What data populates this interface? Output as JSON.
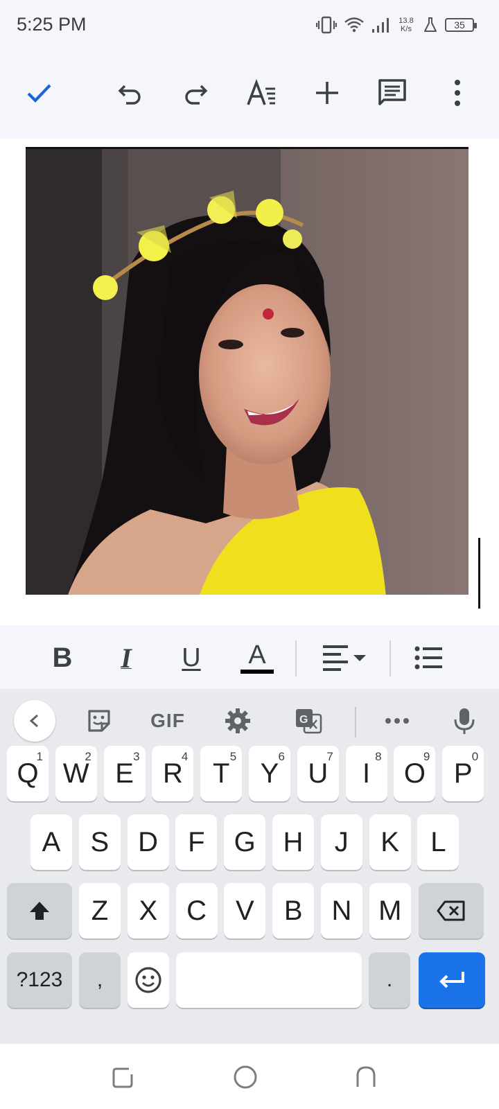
{
  "status_bar": {
    "time": "5:25 PM",
    "net_speed_value": "13.8",
    "net_speed_unit": "K/s",
    "battery": "35"
  },
  "doc_toolbar": {
    "icons": [
      "check-icon",
      "undo-icon",
      "redo-icon",
      "text-format-icon",
      "insert-plus-icon",
      "comment-icon",
      "more-vert-icon"
    ],
    "accent_color": "#1967d2"
  },
  "document": {
    "image_subject": "photo of a smiling woman wearing a yellow flower crown"
  },
  "format_bar": {
    "bold": "B",
    "italic": "I",
    "underline": "U",
    "text_color": "A",
    "icons": [
      "align-left-icon",
      "bulleted-list-icon"
    ]
  },
  "keyboard": {
    "toolbar": {
      "gif_label": "GIF",
      "icons": [
        "chevron-left-icon",
        "sticker-icon",
        "settings-gear-icon",
        "translate-icon",
        "more-horiz-icon",
        "mic-icon"
      ]
    },
    "row1": [
      {
        "label": "Q",
        "hint": "1"
      },
      {
        "label": "W",
        "hint": "2"
      },
      {
        "label": "E",
        "hint": "3"
      },
      {
        "label": "R",
        "hint": "4"
      },
      {
        "label": "T",
        "hint": "5"
      },
      {
        "label": "Y",
        "hint": "6"
      },
      {
        "label": "U",
        "hint": "7"
      },
      {
        "label": "I",
        "hint": "8"
      },
      {
        "label": "O",
        "hint": "9"
      },
      {
        "label": "P",
        "hint": "0"
      }
    ],
    "row2": [
      "A",
      "S",
      "D",
      "F",
      "G",
      "H",
      "J",
      "K",
      "L"
    ],
    "row3": [
      "Z",
      "X",
      "C",
      "V",
      "B",
      "N",
      "M"
    ],
    "row4": {
      "symbols": "?123",
      "comma": ",",
      "period": "."
    },
    "enter_color": "#1a73e8"
  },
  "nav_bar": {
    "icons": [
      "recents-icon",
      "home-icon",
      "back-icon"
    ]
  }
}
